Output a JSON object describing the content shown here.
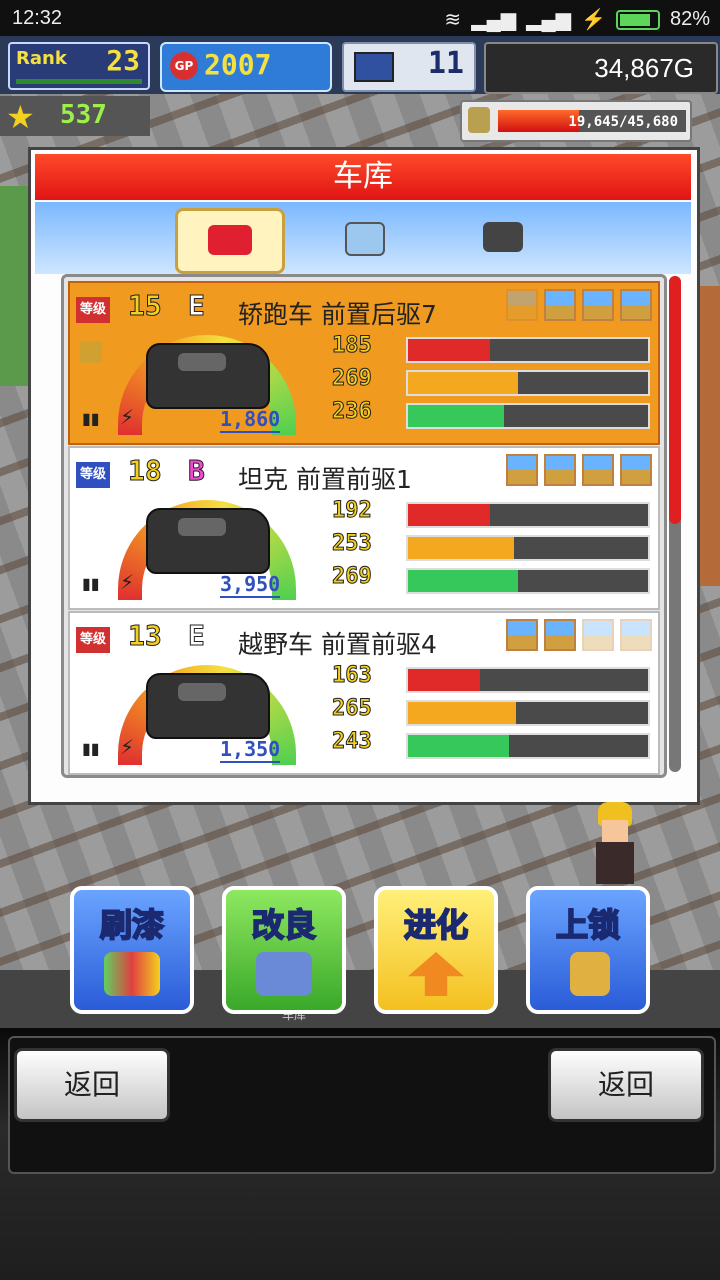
{
  "status_bar": {
    "time": "12:32",
    "battery": "82%"
  },
  "hud": {
    "rank_label": "Rank",
    "rank": "23",
    "gp": "2007",
    "gp_badge": "GP",
    "staff": "11",
    "money": "34,867G",
    "stars": "537",
    "capacity": "19,645/45,680",
    "capacity_fraction": 0.43
  },
  "dialog": {
    "title": "车库",
    "tabs": [
      {
        "icon": "car-icon",
        "active": true
      },
      {
        "icon": "paint-card-icon",
        "active": false
      },
      {
        "icon": "engine-icon",
        "active": false
      }
    ],
    "scroll_fraction": 0.5,
    "cars": [
      {
        "level_tag": "等级",
        "level": "15",
        "grade": "E",
        "name": "轿跑车 前置后驱7",
        "price": "1,860",
        "locked": true,
        "stats": [
          "185",
          "269",
          "236"
        ],
        "fills": [
          0.34,
          0.46,
          0.4
        ],
        "terrain": [
          "faded",
          "ok",
          "ok",
          "x"
        ]
      },
      {
        "level_tag": "等级",
        "level": "18",
        "grade": "B",
        "name": "坦克 前置前驱1",
        "price": "3,950",
        "locked": false,
        "stats": [
          "192",
          "253",
          "269"
        ],
        "fills": [
          0.34,
          0.44,
          0.46
        ],
        "terrain": [
          "ok",
          "ok",
          "ok",
          "ok"
        ]
      },
      {
        "level_tag": "等级",
        "level": "13",
        "grade": "E",
        "name": "越野车 前置前驱4",
        "price": "1,350",
        "locked": false,
        "stats": [
          "163",
          "265",
          "243"
        ],
        "fills": [
          0.3,
          0.45,
          0.42
        ],
        "terrain": [
          "ok",
          "ok",
          "faded",
          "faded"
        ]
      }
    ]
  },
  "actions": {
    "paint": "刷漆",
    "improve": "改良",
    "evolve": "进化",
    "lock": "上锁",
    "tray_caption": "车库"
  },
  "buttons": {
    "back_left": "返回",
    "back_right": "返回"
  },
  "colors": {
    "title_red": "#e01414",
    "selected_row": "#f09a20",
    "stat_red": "#e02a2a",
    "stat_yellow": "#f4a820",
    "stat_green": "#36c85a"
  }
}
